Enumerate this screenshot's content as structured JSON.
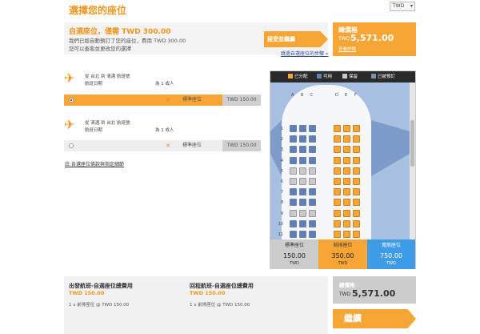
{
  "header": {
    "title": "選擇您的座位",
    "currency": "TWD"
  },
  "info": {
    "headline": "自選座位，僅需 TWD 300.00",
    "line1": "我們已經自動預訂了您的座位，費用 TWD 300.00",
    "line2": "您可以查看並更改您的選擇",
    "accept_label": "接受並繼續",
    "skip_label": "跳過自選座位的步驟 »"
  },
  "total": {
    "label": "總價格",
    "currency": "TWD",
    "amount": "5,571.00",
    "detail_link": "查看詳情"
  },
  "flights": [
    {
      "route": "從 台北    到 清邁    航班號",
      "date_label": "航班日期",
      "pax": "為 1 成人",
      "seat_type": "標準座位",
      "price": "TWD 150.00",
      "selected": true
    },
    {
      "route": "從 清邁    到 台北    航班號",
      "date_label": "航班日期",
      "pax": "為 1 成人",
      "seat_type": "標準座位",
      "price": "TWD 150.00",
      "selected": false
    }
  ],
  "rules_link": "註:自選座位條款與指定細節",
  "seatmap": {
    "legend": [
      {
        "label": "已分配",
        "color": "#f7a534"
      },
      {
        "label": "可用",
        "color": "#5e7fb8"
      },
      {
        "label": "保留",
        "color": "#c9c9c9"
      },
      {
        "label": "已被預訂",
        "color": "#7f8fa8"
      }
    ],
    "columns": [
      "A",
      "B",
      "C",
      "D",
      "E",
      "F"
    ],
    "rows": [
      "1",
      "2",
      "3",
      "4",
      "5",
      "6",
      "7",
      "8",
      "9",
      "10",
      "11"
    ],
    "categories": [
      {
        "name": "標準座位",
        "price": "150.00",
        "currency": "TWD"
      },
      {
        "name": "前排座位",
        "price": "350.00",
        "currency": "TWD"
      },
      {
        "name": "寬敞座位",
        "price": "750.00",
        "currency": "TWD"
      }
    ]
  },
  "summary": {
    "outbound_title": "出發航班-自選座位總費用",
    "outbound_price": "TWD 150.00",
    "outbound_line": "1 x 前排座位 @ TWD 150.00",
    "return_title": "回程航班-自選座位總費用",
    "return_price": "TWD 150.00",
    "return_line": "1 x 前排座位 @ TWD 150.00"
  },
  "bottom_total": {
    "label": "總價格",
    "currency": "TWD",
    "amount": "5,571.00"
  },
  "continue_label": "繼續"
}
